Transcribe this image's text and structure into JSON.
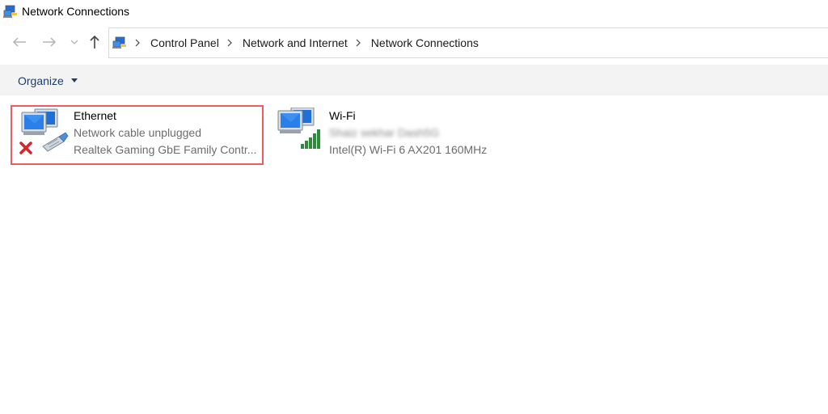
{
  "window": {
    "title": "Network Connections",
    "title_icon": "network-connections-icon"
  },
  "nav": {
    "back_icon": "back-arrow-icon",
    "forward_icon": "forward-arrow-icon",
    "recent_icon": "chevron-down-icon",
    "up_icon": "up-arrow-icon"
  },
  "address_bar": {
    "icon": "control-panel-icon",
    "breadcrumbs": [
      "Control Panel",
      "Network and Internet",
      "Network Connections"
    ]
  },
  "commandbar": {
    "organize_label": "Organize"
  },
  "connections": [
    {
      "name": "Ethernet",
      "status": "Network cable unplugged",
      "device": "Realtek Gaming GbE Family Contr...",
      "icon": "ethernet-adapter-icon",
      "overlay_icon": "disconnected-x-icon",
      "highlighted": true,
      "highlight_color": "#ef5b62"
    },
    {
      "name": "Wi-Fi",
      "status": "Shaiz sekhar Dash5G",
      "device": "Intel(R) Wi-Fi 6 AX201 160MHz",
      "icon": "wifi-adapter-icon",
      "overlay_icon": "signal-bars-icon",
      "highlighted": false
    }
  ],
  "colors": {
    "accent_text": "#1e3a6e",
    "cmdbar_bg": "#f3f3f3",
    "signal": "#2e8b3a",
    "error_x": "#d6262b"
  }
}
